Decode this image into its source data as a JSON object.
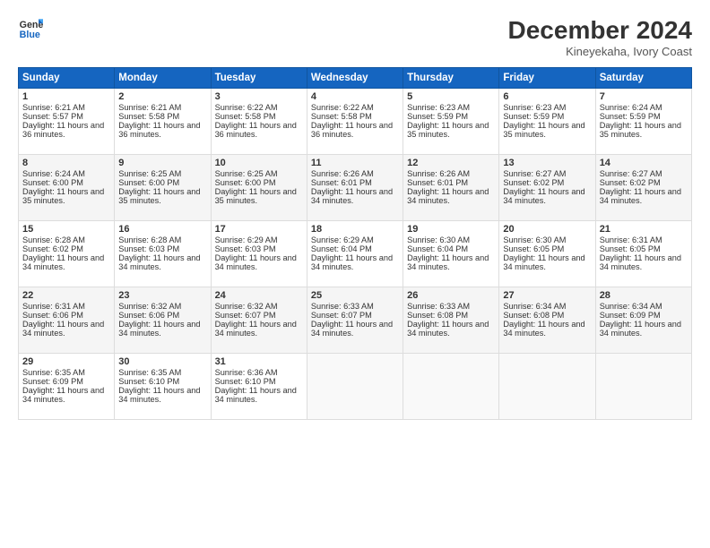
{
  "logo": {
    "line1": "General",
    "line2": "Blue"
  },
  "title": "December 2024",
  "subtitle": "Kineyekaha, Ivory Coast",
  "headers": [
    "Sunday",
    "Monday",
    "Tuesday",
    "Wednesday",
    "Thursday",
    "Friday",
    "Saturday"
  ],
  "weeks": [
    [
      {
        "day": "1",
        "sunrise": "Sunrise: 6:21 AM",
        "sunset": "Sunset: 5:57 PM",
        "daylight": "Daylight: 11 hours and 36 minutes."
      },
      {
        "day": "2",
        "sunrise": "Sunrise: 6:21 AM",
        "sunset": "Sunset: 5:58 PM",
        "daylight": "Daylight: 11 hours and 36 minutes."
      },
      {
        "day": "3",
        "sunrise": "Sunrise: 6:22 AM",
        "sunset": "Sunset: 5:58 PM",
        "daylight": "Daylight: 11 hours and 36 minutes."
      },
      {
        "day": "4",
        "sunrise": "Sunrise: 6:22 AM",
        "sunset": "Sunset: 5:58 PM",
        "daylight": "Daylight: 11 hours and 36 minutes."
      },
      {
        "day": "5",
        "sunrise": "Sunrise: 6:23 AM",
        "sunset": "Sunset: 5:59 PM",
        "daylight": "Daylight: 11 hours and 35 minutes."
      },
      {
        "day": "6",
        "sunrise": "Sunrise: 6:23 AM",
        "sunset": "Sunset: 5:59 PM",
        "daylight": "Daylight: 11 hours and 35 minutes."
      },
      {
        "day": "7",
        "sunrise": "Sunrise: 6:24 AM",
        "sunset": "Sunset: 5:59 PM",
        "daylight": "Daylight: 11 hours and 35 minutes."
      }
    ],
    [
      {
        "day": "8",
        "sunrise": "Sunrise: 6:24 AM",
        "sunset": "Sunset: 6:00 PM",
        "daylight": "Daylight: 11 hours and 35 minutes."
      },
      {
        "day": "9",
        "sunrise": "Sunrise: 6:25 AM",
        "sunset": "Sunset: 6:00 PM",
        "daylight": "Daylight: 11 hours and 35 minutes."
      },
      {
        "day": "10",
        "sunrise": "Sunrise: 6:25 AM",
        "sunset": "Sunset: 6:00 PM",
        "daylight": "Daylight: 11 hours and 35 minutes."
      },
      {
        "day": "11",
        "sunrise": "Sunrise: 6:26 AM",
        "sunset": "Sunset: 6:01 PM",
        "daylight": "Daylight: 11 hours and 34 minutes."
      },
      {
        "day": "12",
        "sunrise": "Sunrise: 6:26 AM",
        "sunset": "Sunset: 6:01 PM",
        "daylight": "Daylight: 11 hours and 34 minutes."
      },
      {
        "day": "13",
        "sunrise": "Sunrise: 6:27 AM",
        "sunset": "Sunset: 6:02 PM",
        "daylight": "Daylight: 11 hours and 34 minutes."
      },
      {
        "day": "14",
        "sunrise": "Sunrise: 6:27 AM",
        "sunset": "Sunset: 6:02 PM",
        "daylight": "Daylight: 11 hours and 34 minutes."
      }
    ],
    [
      {
        "day": "15",
        "sunrise": "Sunrise: 6:28 AM",
        "sunset": "Sunset: 6:02 PM",
        "daylight": "Daylight: 11 hours and 34 minutes."
      },
      {
        "day": "16",
        "sunrise": "Sunrise: 6:28 AM",
        "sunset": "Sunset: 6:03 PM",
        "daylight": "Daylight: 11 hours and 34 minutes."
      },
      {
        "day": "17",
        "sunrise": "Sunrise: 6:29 AM",
        "sunset": "Sunset: 6:03 PM",
        "daylight": "Daylight: 11 hours and 34 minutes."
      },
      {
        "day": "18",
        "sunrise": "Sunrise: 6:29 AM",
        "sunset": "Sunset: 6:04 PM",
        "daylight": "Daylight: 11 hours and 34 minutes."
      },
      {
        "day": "19",
        "sunrise": "Sunrise: 6:30 AM",
        "sunset": "Sunset: 6:04 PM",
        "daylight": "Daylight: 11 hours and 34 minutes."
      },
      {
        "day": "20",
        "sunrise": "Sunrise: 6:30 AM",
        "sunset": "Sunset: 6:05 PM",
        "daylight": "Daylight: 11 hours and 34 minutes."
      },
      {
        "day": "21",
        "sunrise": "Sunrise: 6:31 AM",
        "sunset": "Sunset: 6:05 PM",
        "daylight": "Daylight: 11 hours and 34 minutes."
      }
    ],
    [
      {
        "day": "22",
        "sunrise": "Sunrise: 6:31 AM",
        "sunset": "Sunset: 6:06 PM",
        "daylight": "Daylight: 11 hours and 34 minutes."
      },
      {
        "day": "23",
        "sunrise": "Sunrise: 6:32 AM",
        "sunset": "Sunset: 6:06 PM",
        "daylight": "Daylight: 11 hours and 34 minutes."
      },
      {
        "day": "24",
        "sunrise": "Sunrise: 6:32 AM",
        "sunset": "Sunset: 6:07 PM",
        "daylight": "Daylight: 11 hours and 34 minutes."
      },
      {
        "day": "25",
        "sunrise": "Sunrise: 6:33 AM",
        "sunset": "Sunset: 6:07 PM",
        "daylight": "Daylight: 11 hours and 34 minutes."
      },
      {
        "day": "26",
        "sunrise": "Sunrise: 6:33 AM",
        "sunset": "Sunset: 6:08 PM",
        "daylight": "Daylight: 11 hours and 34 minutes."
      },
      {
        "day": "27",
        "sunrise": "Sunrise: 6:34 AM",
        "sunset": "Sunset: 6:08 PM",
        "daylight": "Daylight: 11 hours and 34 minutes."
      },
      {
        "day": "28",
        "sunrise": "Sunrise: 6:34 AM",
        "sunset": "Sunset: 6:09 PM",
        "daylight": "Daylight: 11 hours and 34 minutes."
      }
    ],
    [
      {
        "day": "29",
        "sunrise": "Sunrise: 6:35 AM",
        "sunset": "Sunset: 6:09 PM",
        "daylight": "Daylight: 11 hours and 34 minutes."
      },
      {
        "day": "30",
        "sunrise": "Sunrise: 6:35 AM",
        "sunset": "Sunset: 6:10 PM",
        "daylight": "Daylight: 11 hours and 34 minutes."
      },
      {
        "day": "31",
        "sunrise": "Sunrise: 6:36 AM",
        "sunset": "Sunset: 6:10 PM",
        "daylight": "Daylight: 11 hours and 34 minutes."
      },
      null,
      null,
      null,
      null
    ]
  ]
}
